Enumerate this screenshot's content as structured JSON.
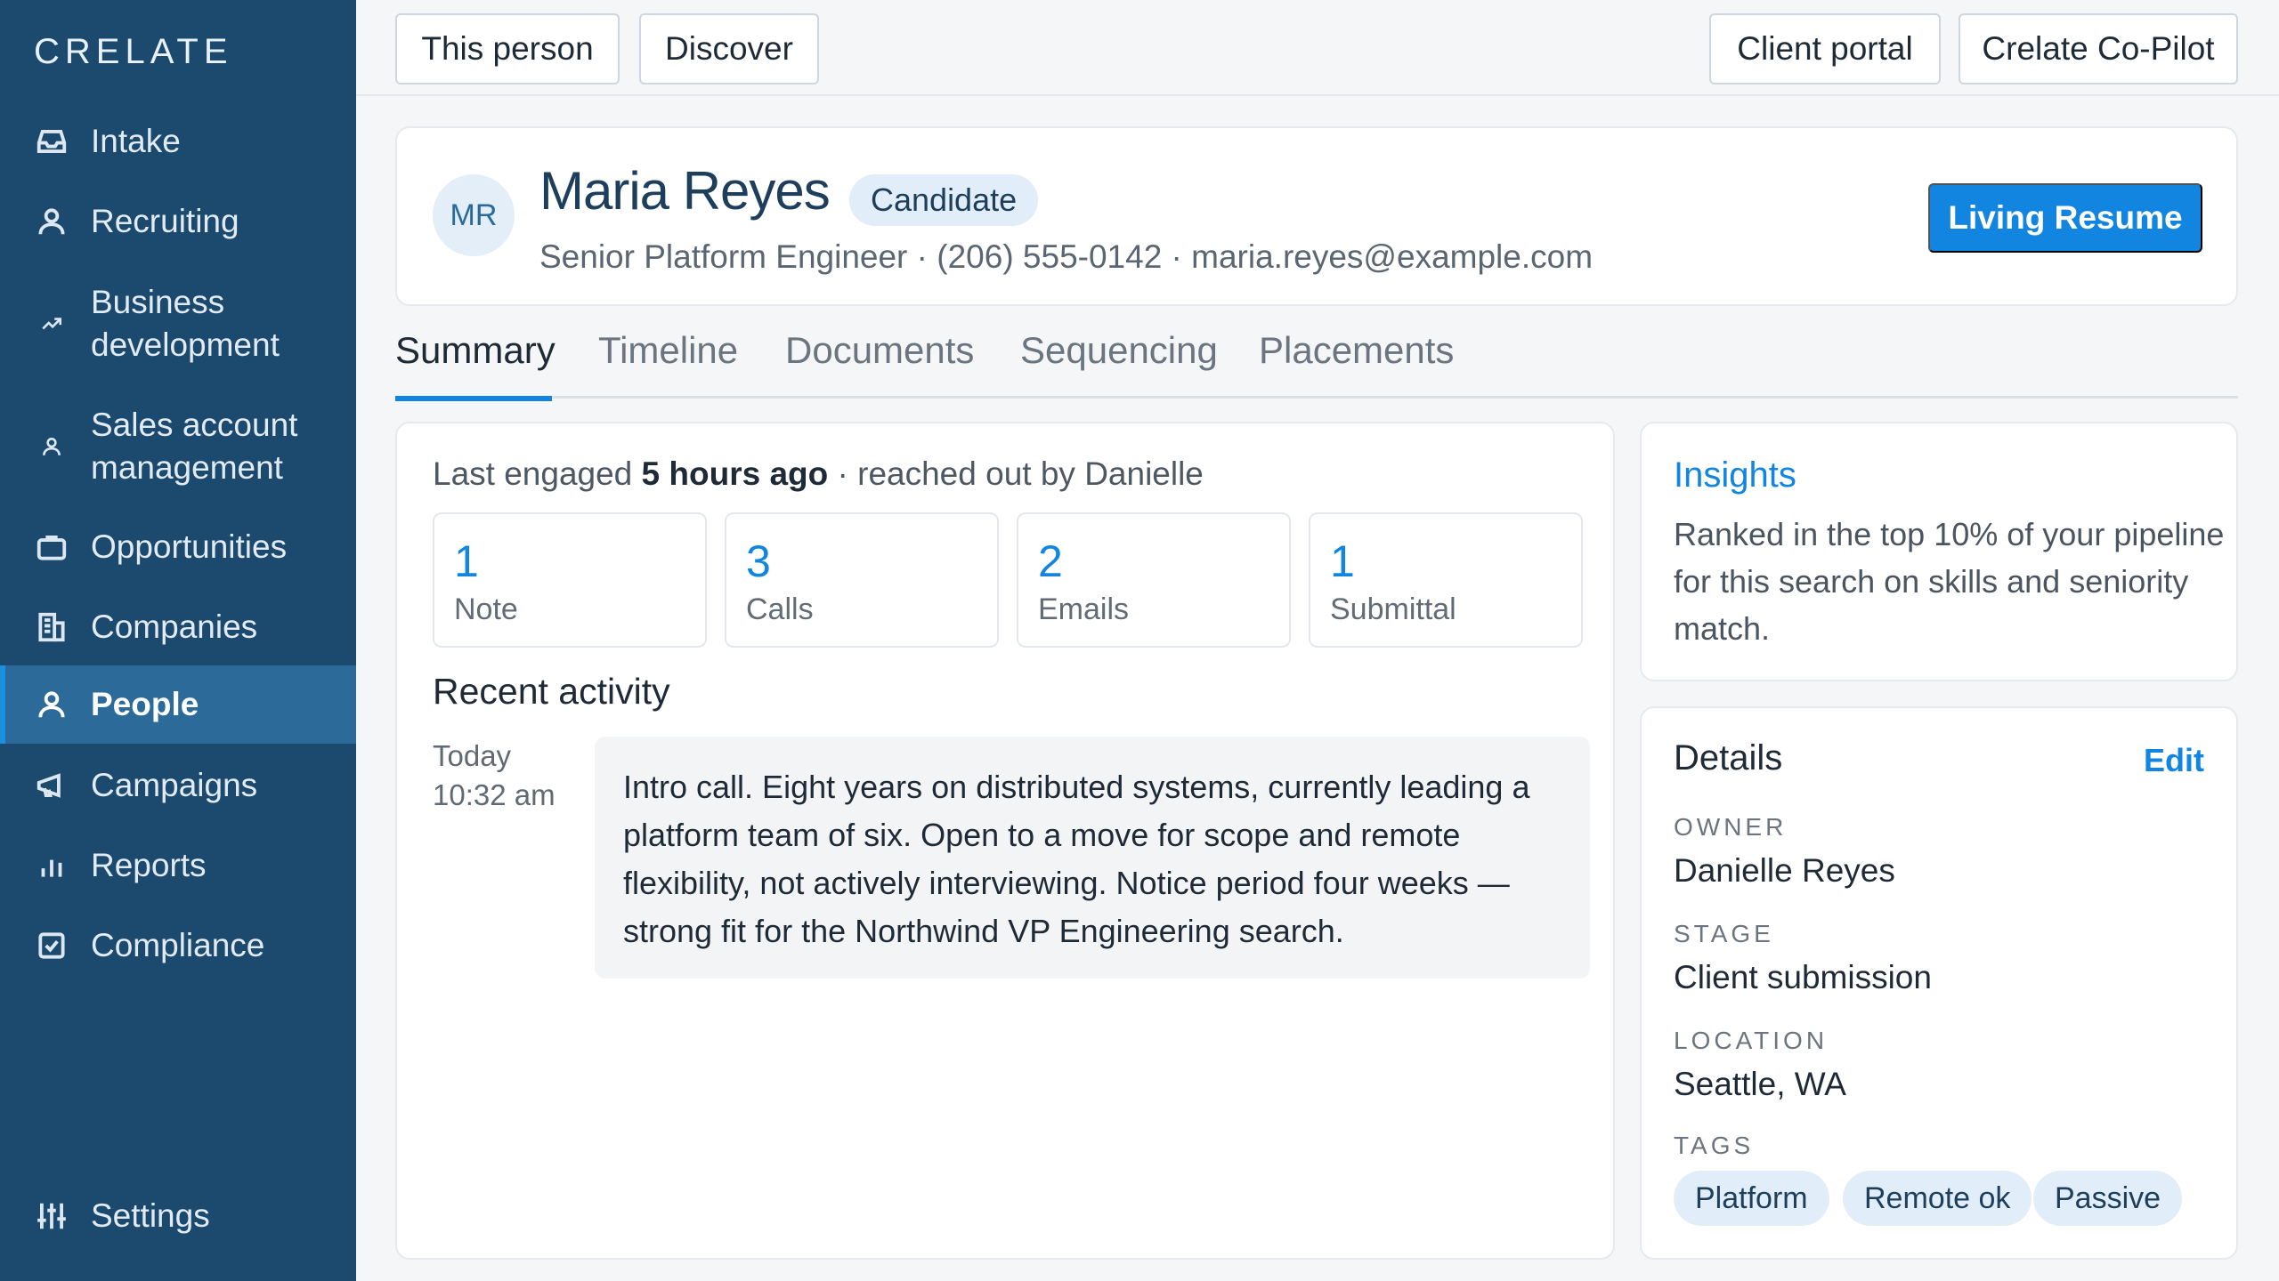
{
  "sidebar": {
    "brand": "CRELATE",
    "items": [
      {
        "label": "Intake",
        "icon": "inbox-icon"
      },
      {
        "label": "Recruiting",
        "icon": "user-icon"
      },
      {
        "label": "Business development",
        "line1": "Business",
        "line2": "development",
        "icon": "trending-up-icon"
      },
      {
        "label": "Sales account management",
        "line1": "Sales account",
        "line2": "management",
        "icon": "user-icon"
      },
      {
        "label": "Opportunities",
        "icon": "briefcase-icon"
      },
      {
        "label": "Companies",
        "icon": "building-icon"
      },
      {
        "label": "People",
        "icon": "person-icon",
        "active": true
      },
      {
        "label": "Campaigns",
        "icon": "megaphone-icon"
      },
      {
        "label": "Reports",
        "icon": "bar-chart-icon"
      },
      {
        "label": "Compliance",
        "icon": "checkbox-icon"
      }
    ],
    "settings_label": "Settings"
  },
  "topbar": {
    "this_person": "This person",
    "discover": "Discover",
    "client_portal": "Client portal",
    "copilot": "Crelate Co-Pilot"
  },
  "profile": {
    "initials": "MR",
    "name": "Maria Reyes",
    "badge": "Candidate",
    "subline": "Senior Platform Engineer · (206) 555-0142 · maria.reyes@example.com",
    "primary_button": "Living Resume"
  },
  "tabs": [
    "Summary",
    "Timeline",
    "Documents",
    "Sequencing",
    "Placements"
  ],
  "summary": {
    "engaged_prefix": "Last engaged ",
    "engaged_time": "5 hours ago",
    "engaged_suffix": " · reached out by Danielle",
    "stats": [
      {
        "value": "1",
        "label": "Note"
      },
      {
        "value": "3",
        "label": "Calls"
      },
      {
        "value": "2",
        "label": "Emails"
      },
      {
        "value": "1",
        "label": "Submittal"
      }
    ],
    "recent_title": "Recent activity",
    "activity": {
      "day": "Today",
      "time": "10:32 am",
      "text": "Intro call. Eight years on distributed systems, currently leading a platform team of six. Open to a move for scope and remote flexibility, not actively interviewing. Notice period four weeks — strong fit for the Northwind VP Engineering search."
    }
  },
  "insights": {
    "title": "Insights",
    "text": "Ranked in the top 10% of your pipeline for this search on skills and seniority match."
  },
  "details": {
    "title": "Details",
    "edit": "Edit",
    "owner_label": "OWNER",
    "owner": "Danielle Reyes",
    "stage_label": "STAGE",
    "stage": "Client submission",
    "location_label": "LOCATION",
    "location": "Seattle, WA",
    "tags_label": "TAGS",
    "tags": [
      "Platform",
      "Remote ok",
      "Passive"
    ]
  },
  "colors": {
    "sidebar_bg": "#1b4a6e",
    "sidebar_active": "#2c6b99",
    "accent": "#1185e0"
  }
}
